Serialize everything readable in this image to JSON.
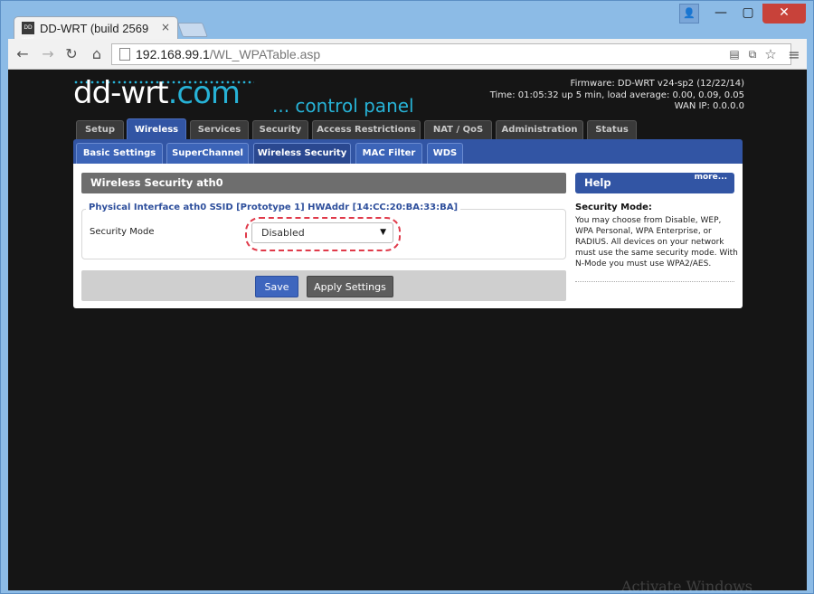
{
  "browser": {
    "tab_title": "DD-WRT (build 2569",
    "tab_close": "×",
    "favicon_text": "DD WRT",
    "window_buttons": {
      "user": "👤",
      "minimize": "—",
      "maximize": "▢",
      "close": "✕"
    },
    "nav": {
      "back": "←",
      "forward": "→",
      "reload": "↻",
      "home": "⌂",
      "menu": "≡"
    },
    "url_host": "192.168.99.1",
    "url_path": "/WL_WPATable.asp",
    "icons": {
      "page_action": "▤",
      "translate": "⧉",
      "star": "☆"
    }
  },
  "header": {
    "logo_main": "dd-wrt",
    "logo_com": ".com",
    "control_panel": "... control panel",
    "firmware": "Firmware: DD-WRT v24-sp2 (12/22/14)",
    "time": "Time: 01:05:32 up 5 min, load average: 0.00, 0.09, 0.05",
    "wan_ip": "WAN IP: 0.0.0.0"
  },
  "main_tabs": [
    {
      "label": "Setup",
      "active": false
    },
    {
      "label": "Wireless",
      "active": true
    },
    {
      "label": "Services",
      "active": false
    },
    {
      "label": "Security",
      "active": false
    },
    {
      "label": "Access Restrictions",
      "active": false
    },
    {
      "label": "NAT / QoS",
      "active": false
    },
    {
      "label": "Administration",
      "active": false
    },
    {
      "label": "Status",
      "active": false
    }
  ],
  "sub_tabs": [
    {
      "label": "Basic Settings",
      "active": false
    },
    {
      "label": "SuperChannel",
      "active": false
    },
    {
      "label": "Wireless Security",
      "active": true
    },
    {
      "label": "MAC Filter",
      "active": false
    },
    {
      "label": "WDS",
      "active": false
    }
  ],
  "section": {
    "title": "Wireless Security ath0",
    "legend": "Physical Interface ath0 SSID [Prototype 1] HWAddr [14:CC:20:BA:33:BA]",
    "security_mode_label": "Security Mode",
    "security_mode_value": "Disabled",
    "dropdown_arrow": "▼"
  },
  "buttons": {
    "save": "Save",
    "apply": "Apply Settings"
  },
  "help": {
    "title": "Help",
    "more": "more...",
    "topic": "Security Mode:",
    "body": "You may choose from Disable, WEP, WPA Personal, WPA Enterprise, or RADIUS. All devices on your network must use the same security mode. With N-Mode you must use WPA2/AES."
  },
  "watermark": "Activate Windows"
}
